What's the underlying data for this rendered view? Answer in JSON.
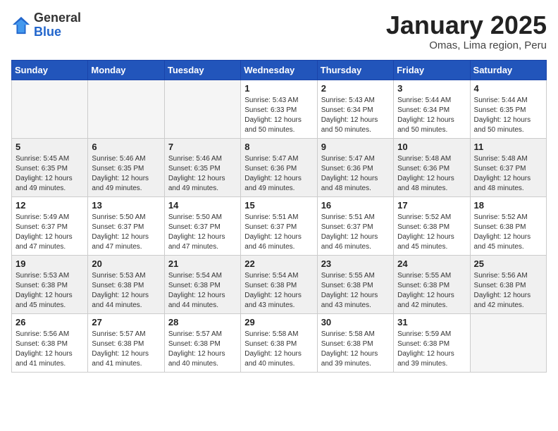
{
  "header": {
    "logo": {
      "line1": "General",
      "line2": "Blue"
    },
    "title": "January 2025",
    "subtitle": "Omas, Lima region, Peru"
  },
  "weekdays": [
    "Sunday",
    "Monday",
    "Tuesday",
    "Wednesday",
    "Thursday",
    "Friday",
    "Saturday"
  ],
  "weeks": [
    [
      {
        "day": "",
        "info": ""
      },
      {
        "day": "",
        "info": ""
      },
      {
        "day": "",
        "info": ""
      },
      {
        "day": "1",
        "info": "Sunrise: 5:43 AM\nSunset: 6:33 PM\nDaylight: 12 hours\nand 50 minutes."
      },
      {
        "day": "2",
        "info": "Sunrise: 5:43 AM\nSunset: 6:34 PM\nDaylight: 12 hours\nand 50 minutes."
      },
      {
        "day": "3",
        "info": "Sunrise: 5:44 AM\nSunset: 6:34 PM\nDaylight: 12 hours\nand 50 minutes."
      },
      {
        "day": "4",
        "info": "Sunrise: 5:44 AM\nSunset: 6:35 PM\nDaylight: 12 hours\nand 50 minutes."
      }
    ],
    [
      {
        "day": "5",
        "info": "Sunrise: 5:45 AM\nSunset: 6:35 PM\nDaylight: 12 hours\nand 49 minutes."
      },
      {
        "day": "6",
        "info": "Sunrise: 5:46 AM\nSunset: 6:35 PM\nDaylight: 12 hours\nand 49 minutes."
      },
      {
        "day": "7",
        "info": "Sunrise: 5:46 AM\nSunset: 6:35 PM\nDaylight: 12 hours\nand 49 minutes."
      },
      {
        "day": "8",
        "info": "Sunrise: 5:47 AM\nSunset: 6:36 PM\nDaylight: 12 hours\nand 49 minutes."
      },
      {
        "day": "9",
        "info": "Sunrise: 5:47 AM\nSunset: 6:36 PM\nDaylight: 12 hours\nand 48 minutes."
      },
      {
        "day": "10",
        "info": "Sunrise: 5:48 AM\nSunset: 6:36 PM\nDaylight: 12 hours\nand 48 minutes."
      },
      {
        "day": "11",
        "info": "Sunrise: 5:48 AM\nSunset: 6:37 PM\nDaylight: 12 hours\nand 48 minutes."
      }
    ],
    [
      {
        "day": "12",
        "info": "Sunrise: 5:49 AM\nSunset: 6:37 PM\nDaylight: 12 hours\nand 47 minutes."
      },
      {
        "day": "13",
        "info": "Sunrise: 5:50 AM\nSunset: 6:37 PM\nDaylight: 12 hours\nand 47 minutes."
      },
      {
        "day": "14",
        "info": "Sunrise: 5:50 AM\nSunset: 6:37 PM\nDaylight: 12 hours\nand 47 minutes."
      },
      {
        "day": "15",
        "info": "Sunrise: 5:51 AM\nSunset: 6:37 PM\nDaylight: 12 hours\nand 46 minutes."
      },
      {
        "day": "16",
        "info": "Sunrise: 5:51 AM\nSunset: 6:37 PM\nDaylight: 12 hours\nand 46 minutes."
      },
      {
        "day": "17",
        "info": "Sunrise: 5:52 AM\nSunset: 6:38 PM\nDaylight: 12 hours\nand 45 minutes."
      },
      {
        "day": "18",
        "info": "Sunrise: 5:52 AM\nSunset: 6:38 PM\nDaylight: 12 hours\nand 45 minutes."
      }
    ],
    [
      {
        "day": "19",
        "info": "Sunrise: 5:53 AM\nSunset: 6:38 PM\nDaylight: 12 hours\nand 45 minutes."
      },
      {
        "day": "20",
        "info": "Sunrise: 5:53 AM\nSunset: 6:38 PM\nDaylight: 12 hours\nand 44 minutes."
      },
      {
        "day": "21",
        "info": "Sunrise: 5:54 AM\nSunset: 6:38 PM\nDaylight: 12 hours\nand 44 minutes."
      },
      {
        "day": "22",
        "info": "Sunrise: 5:54 AM\nSunset: 6:38 PM\nDaylight: 12 hours\nand 43 minutes."
      },
      {
        "day": "23",
        "info": "Sunrise: 5:55 AM\nSunset: 6:38 PM\nDaylight: 12 hours\nand 43 minutes."
      },
      {
        "day": "24",
        "info": "Sunrise: 5:55 AM\nSunset: 6:38 PM\nDaylight: 12 hours\nand 42 minutes."
      },
      {
        "day": "25",
        "info": "Sunrise: 5:56 AM\nSunset: 6:38 PM\nDaylight: 12 hours\nand 42 minutes."
      }
    ],
    [
      {
        "day": "26",
        "info": "Sunrise: 5:56 AM\nSunset: 6:38 PM\nDaylight: 12 hours\nand 41 minutes."
      },
      {
        "day": "27",
        "info": "Sunrise: 5:57 AM\nSunset: 6:38 PM\nDaylight: 12 hours\nand 41 minutes."
      },
      {
        "day": "28",
        "info": "Sunrise: 5:57 AM\nSunset: 6:38 PM\nDaylight: 12 hours\nand 40 minutes."
      },
      {
        "day": "29",
        "info": "Sunrise: 5:58 AM\nSunset: 6:38 PM\nDaylight: 12 hours\nand 40 minutes."
      },
      {
        "day": "30",
        "info": "Sunrise: 5:58 AM\nSunset: 6:38 PM\nDaylight: 12 hours\nand 39 minutes."
      },
      {
        "day": "31",
        "info": "Sunrise: 5:59 AM\nSunset: 6:38 PM\nDaylight: 12 hours\nand 39 minutes."
      },
      {
        "day": "",
        "info": ""
      }
    ]
  ]
}
